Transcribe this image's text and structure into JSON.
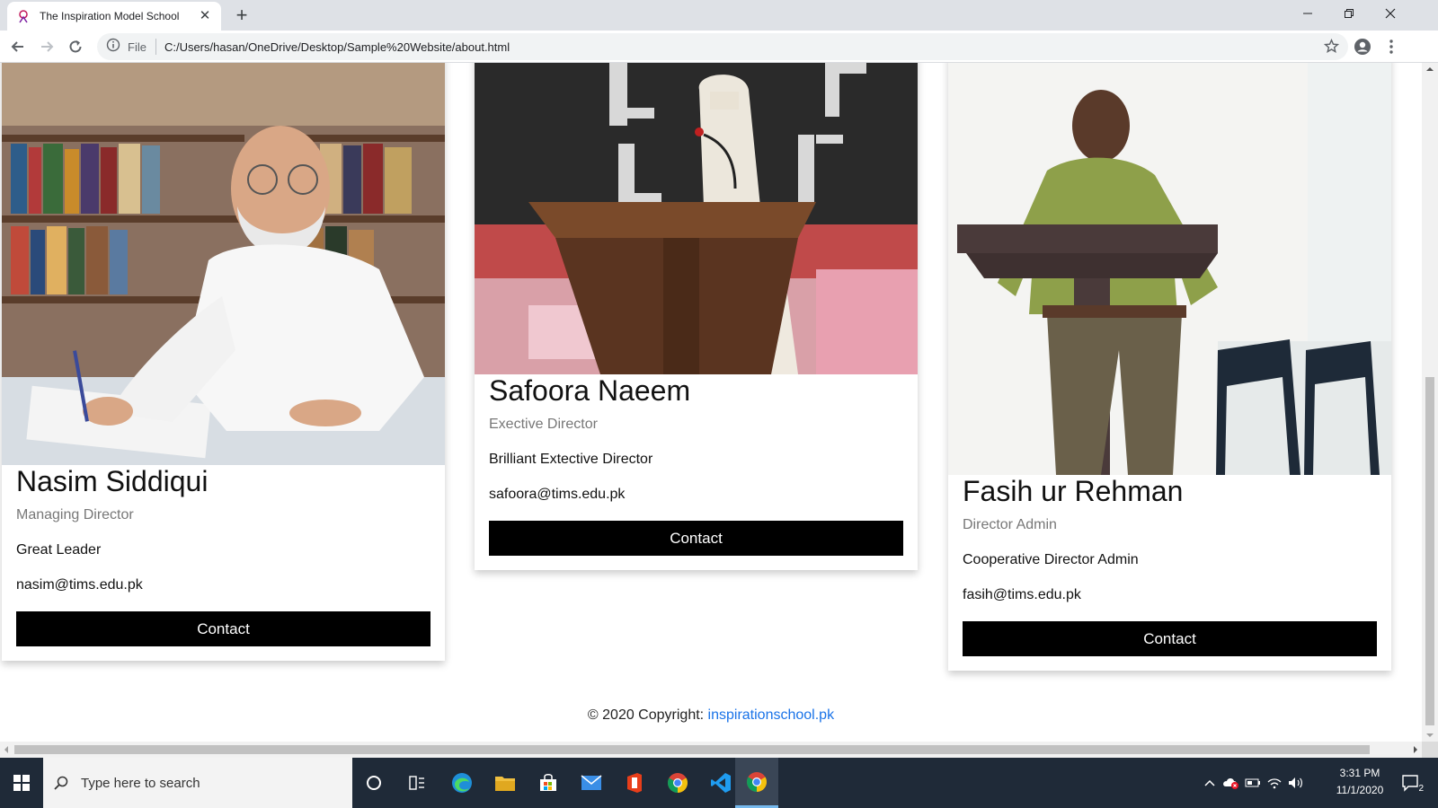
{
  "browser": {
    "tab_title": "The Inspiration Model School",
    "omnibox_scheme": "File",
    "url": "C:/Users/hasan/OneDrive/Desktop/Sample%20Website/about.html"
  },
  "team": [
    {
      "name": "Nasim Siddiqui",
      "role": "Managing Director",
      "description": "Great Leader",
      "email": "nasim@tims.edu.pk",
      "button": "Contact"
    },
    {
      "name": "Safoora Naeem",
      "role": "Exective Director",
      "description": "Brilliant Extective Director",
      "email": "safoora@tims.edu.pk",
      "button": "Contact"
    },
    {
      "name": "Fasih ur Rehman",
      "role": "Director Admin",
      "description": "Cooperative Director Admin",
      "email": "fasih@tims.edu.pk",
      "button": "Contact"
    }
  ],
  "footer": {
    "copyright": "© 2020 Copyright: ",
    "link_text": "inspirationschool.pk"
  },
  "taskbar": {
    "search_placeholder": "Type here to search",
    "time": "3:31 PM",
    "date": "11/1/2020",
    "notification_count": "2"
  },
  "colors": {
    "button_bg": "#000000",
    "link": "#1a73e8",
    "taskbar_bg": "#1f2a38"
  }
}
